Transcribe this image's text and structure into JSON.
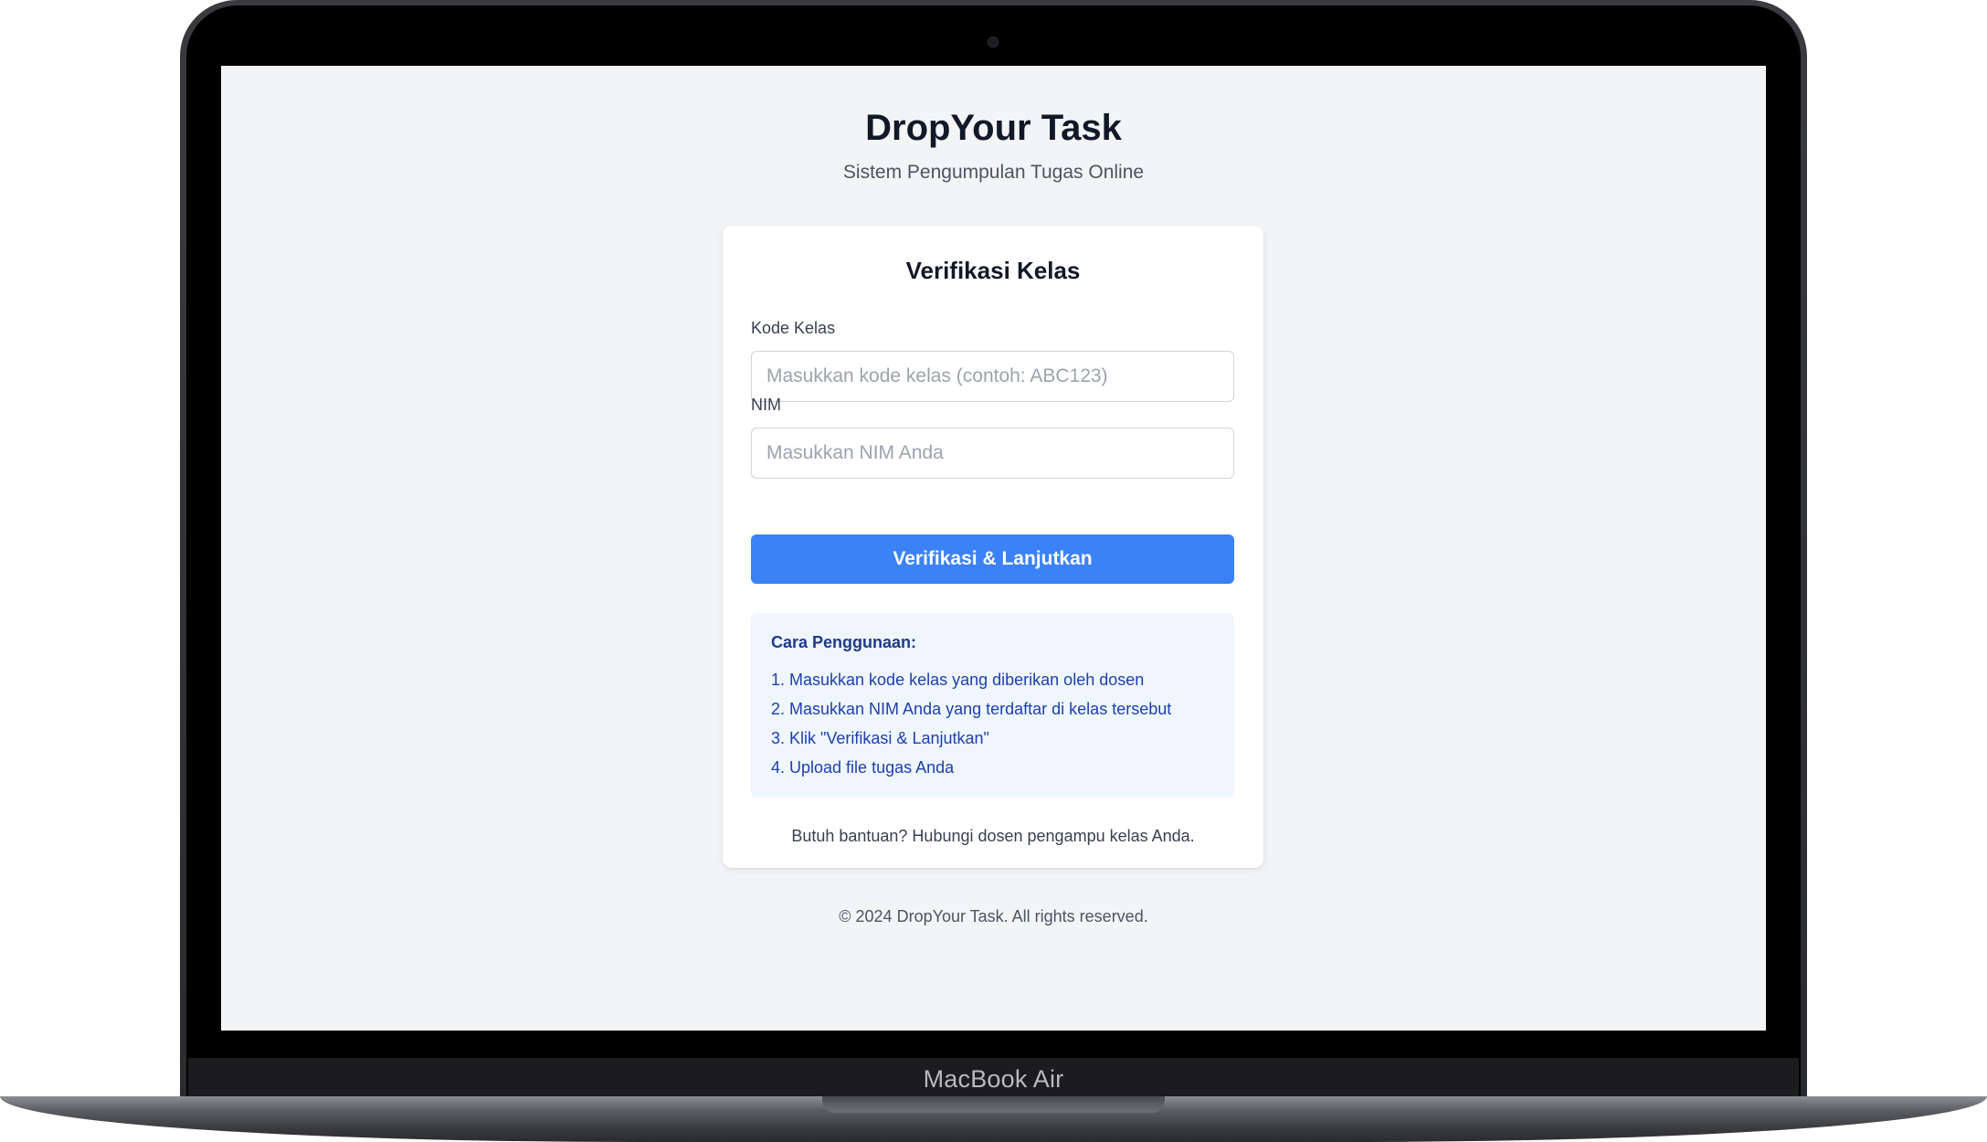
{
  "device": {
    "label": "MacBook Air"
  },
  "header": {
    "title": "DropYour Task",
    "subtitle": "Sistem Pengumpulan Tugas Online"
  },
  "card": {
    "title": "Verifikasi Kelas",
    "class_code": {
      "label": "Kode Kelas",
      "placeholder": "Masukkan kode kelas (contoh: ABC123)",
      "value": ""
    },
    "nim": {
      "label": "NIM",
      "placeholder": "Masukkan NIM Anda",
      "value": ""
    },
    "submit_label": "Verifikasi & Lanjutkan",
    "help": {
      "title": "Cara Penggunaan:",
      "steps": [
        "1. Masukkan kode kelas yang diberikan oleh dosen",
        "2. Masukkan NIM Anda yang terdaftar di kelas tersebut",
        "3. Klik \"Verifikasi & Lanjutkan\"",
        "4. Upload file tugas Anda"
      ]
    },
    "help_note": "Butuh bantuan? Hubungi dosen pengampu kelas Anda."
  },
  "footer": {
    "text": "© 2024 DropYour Task. All rights reserved."
  },
  "colors": {
    "accent": "#3b82f6",
    "background": "#f3f4f6",
    "help_bg": "#eff6ff",
    "help_text": "#1e40af"
  }
}
